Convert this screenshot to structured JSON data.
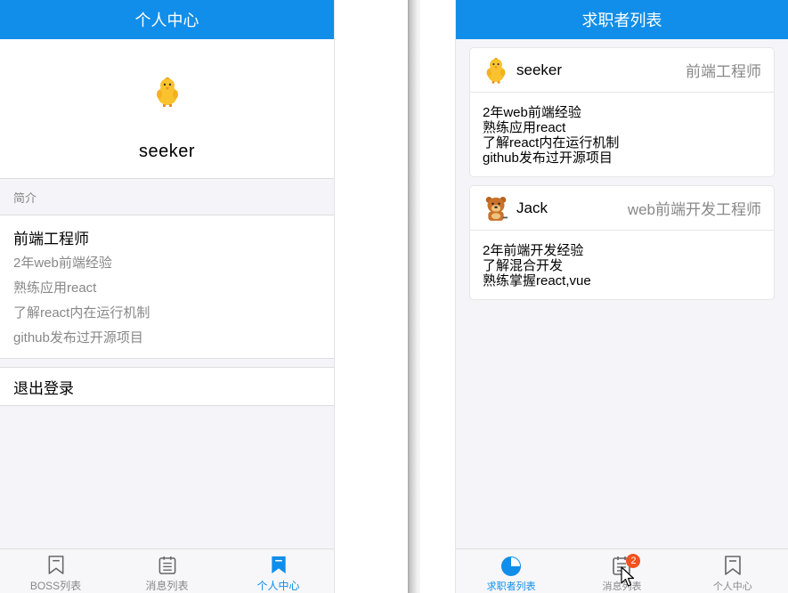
{
  "left": {
    "navbar_title": "个人中心",
    "profile": {
      "avatar_icon": "chick-avatar-icon",
      "name": "seeker"
    },
    "intro_header": "简介",
    "intro": {
      "title": "前端工程师",
      "lines": [
        "2年web前端经验",
        "熟练应用react",
        "了解react内在运行机制",
        "github发布过开源项目"
      ]
    },
    "logout_label": "退出登录",
    "tabs": [
      {
        "label": "BOSS列表",
        "icon": "bookmark-icon",
        "active": false
      },
      {
        "label": "消息列表",
        "icon": "calendar-list-icon",
        "active": false
      },
      {
        "label": "个人中心",
        "icon": "bookmark-filled-icon",
        "active": true
      }
    ]
  },
  "right": {
    "navbar_title": "求职者列表",
    "cards": [
      {
        "avatar_icon": "chick-avatar-icon",
        "name": "seeker",
        "title": "前端工程师",
        "lines": [
          "2年web前端经验",
          "熟练应用react",
          "了解react内在运行机制",
          "github发布过开源项目"
        ]
      },
      {
        "avatar_icon": "bear-avatar-icon",
        "name": "Jack",
        "title": "web前端开发工程师",
        "lines": [
          "2年前端开发经验",
          "了解混合开发",
          "熟练掌握react,vue"
        ]
      }
    ],
    "tabs": [
      {
        "label": "求职者列表",
        "icon": "pie-chart-icon",
        "active": true
      },
      {
        "label": "消息列表",
        "icon": "calendar-list-icon",
        "active": false,
        "badge": "2"
      },
      {
        "label": "个人中心",
        "icon": "bookmark-icon",
        "active": false
      }
    ]
  },
  "colors": {
    "primary": "#108ee9",
    "badge": "#f4511e",
    "muted": "#888888"
  }
}
